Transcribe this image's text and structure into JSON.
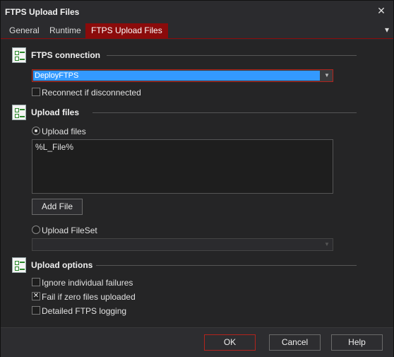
{
  "window": {
    "title": "FTPS Upload Files",
    "close_symbol": "✕"
  },
  "tabs": [
    {
      "label": "General"
    },
    {
      "label": "Runtime"
    },
    {
      "label": "FTPS Upload Files",
      "active": true
    }
  ],
  "tab_menu_symbol": "▾",
  "ftps_connection": {
    "title": "FTPS connection",
    "selected": "DeployFTPS",
    "reconnect_label": "Reconnect if disconnected",
    "reconnect_checked": false
  },
  "upload_files": {
    "title": "Upload files",
    "radio_files_label": "Upload files",
    "radio_files_selected": true,
    "files_text": "%L_File%",
    "add_file_label": "Add File",
    "radio_fileset_label": "Upload FileSet",
    "radio_fileset_selected": false,
    "fileset_value": ""
  },
  "upload_options": {
    "title": "Upload options",
    "ignore_failures_label": "Ignore individual failures",
    "ignore_failures_checked": false,
    "fail_zero_label": "Fail if zero files uploaded",
    "fail_zero_checked": true,
    "fail_zero_mark": "✕",
    "detailed_logging_label": "Detailed FTPS logging",
    "detailed_logging_checked": false
  },
  "buttons": {
    "ok": "OK",
    "cancel": "Cancel",
    "help": "Help"
  },
  "colors": {
    "accent": "#8b0b0b",
    "selection": "#3399ff",
    "focus_border": "#b3241d"
  }
}
